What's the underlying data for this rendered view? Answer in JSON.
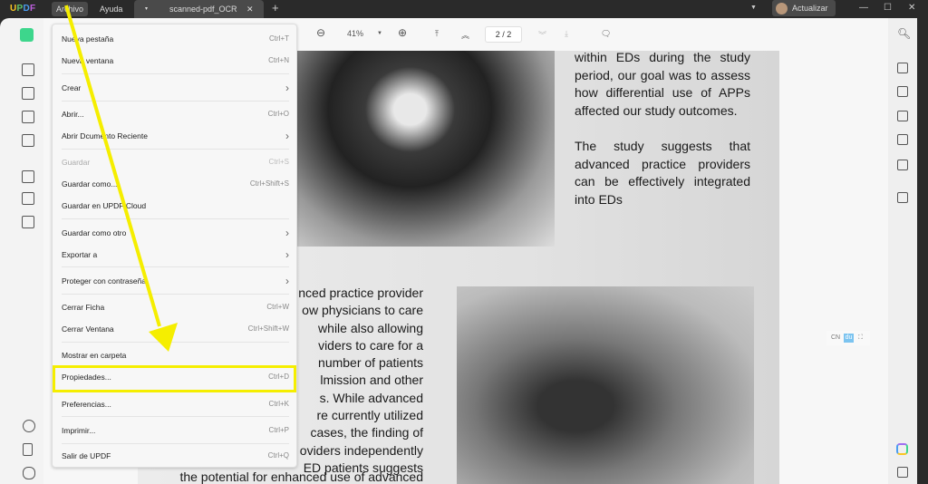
{
  "app": {
    "logo": "UPDF",
    "menus": [
      "Archivo",
      "Ayuda"
    ],
    "tab_title": "scanned-pdf_OCR",
    "update_label": "Actualizar"
  },
  "toolbar": {
    "zoom": "41%",
    "page": "2 / 2"
  },
  "menu": {
    "items": [
      {
        "label": "Nueva pestaña",
        "shortcut": "Ctrl+T"
      },
      {
        "label": "Nueva ventana",
        "shortcut": "Ctrl+N"
      },
      {
        "label": "Crear",
        "shortcut": "›"
      },
      {
        "label": "Abrir...",
        "shortcut": "Ctrl+O"
      },
      {
        "label": "Abrir Dcumento Reciente",
        "shortcut": "›"
      },
      {
        "label": "Guardar",
        "shortcut": "Ctrl+S"
      },
      {
        "label": "Guardar como...",
        "shortcut": "Ctrl+Shift+S"
      },
      {
        "label": "Guardar en UPDF Cloud",
        "shortcut": ""
      },
      {
        "label": "Guardar como otro",
        "shortcut": "›"
      },
      {
        "label": "Exportar a",
        "shortcut": "›"
      },
      {
        "label": "Proteger con contraseña",
        "shortcut": "›"
      },
      {
        "label": "Cerrar Ficha",
        "shortcut": "Ctrl+W"
      },
      {
        "label": "Cerrar Ventana",
        "shortcut": "Ctrl+Shift+W"
      },
      {
        "label": "Mostrar en carpeta",
        "shortcut": ""
      },
      {
        "label": "Propiedades...",
        "shortcut": "Ctrl+D"
      },
      {
        "label": "Preferencias...",
        "shortcut": "Ctrl+K"
      },
      {
        "label": "Imprimir...",
        "shortcut": "Ctrl+P"
      },
      {
        "label": "Salir de UPDF",
        "shortcut": "Ctrl+Q"
      }
    ]
  },
  "document": {
    "right_paragraphs": [
      "within EDs during the study period, our goal was to assess how differential use of APPs affected our study outcomes.",
      "The study suggests that advanced practice providers can be effectively integrated into EDs"
    ],
    "left_lines": [
      "nced practice provider",
      "ow physicians to care",
      "while also allowing",
      "viders to care for a",
      "number of patients",
      "lmission and other",
      "s. While advanced",
      "re currently utilized",
      "cases, the finding of",
      "oviders independently",
      "ED patients suggests",
      "the potential for enhanced use of advanced"
    ]
  },
  "ocr_controls": {
    "left": "CN",
    "right": "du"
  },
  "colors": {
    "highlight": "#f5ee00",
    "accent": "#3dd68c"
  }
}
